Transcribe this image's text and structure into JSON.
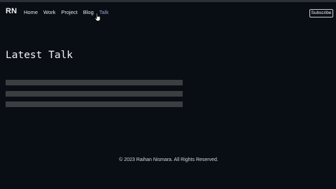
{
  "nav": {
    "logo": "RN",
    "links": [
      {
        "label": "Home"
      },
      {
        "label": "Work"
      },
      {
        "label": "Project"
      },
      {
        "label": "Blog"
      },
      {
        "label": "Talk"
      }
    ],
    "active_link": "Talk",
    "subscribe_label": "Subscribe"
  },
  "main": {
    "title": "Latest Talk",
    "loading_placeholders": 3
  },
  "footer": {
    "copyright": "© 2023 Raihan Nismara. All Rights Reserved."
  },
  "colors": {
    "background": "#090d14",
    "active_link": "#8fa6c4",
    "skeleton": "#3b3f41"
  }
}
